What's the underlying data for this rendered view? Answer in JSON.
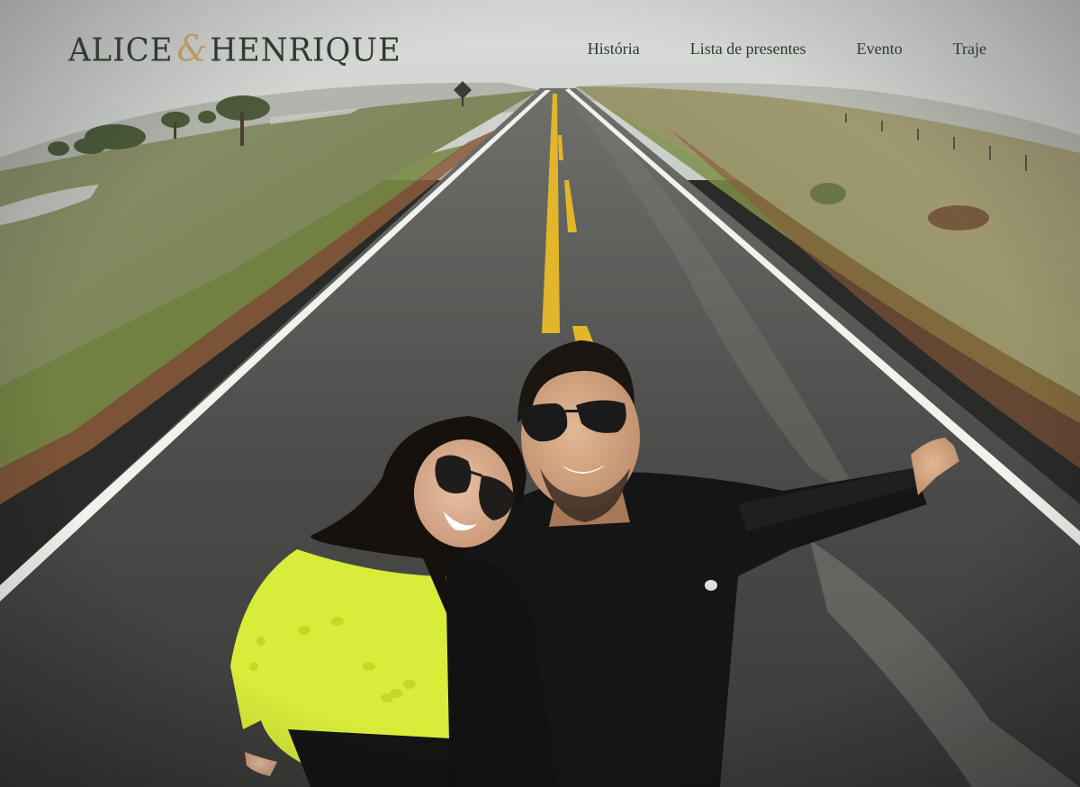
{
  "header": {
    "logo": {
      "first_name": "ALICE",
      "ampersand": "&",
      "second_name": "HENRIQUE"
    },
    "nav": [
      {
        "label": "História"
      },
      {
        "label": "Lista de presentes"
      },
      {
        "label": "Evento"
      },
      {
        "label": "Traje"
      }
    ]
  },
  "hero": {
    "image": "couple-selfie-on-road-photo"
  },
  "colors": {
    "logo_text": "#2f3a30",
    "ampersand_accent": "#b89a6a",
    "road_line_yellow": "#e2b62a",
    "sweater_lime": "#d8ec3a"
  }
}
